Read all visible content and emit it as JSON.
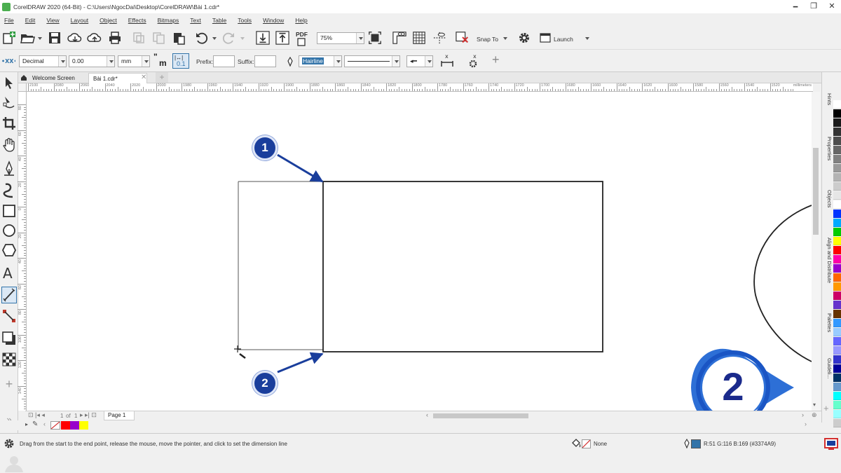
{
  "window": {
    "title": "CorelDRAW 2020 (64-Bit) - C:\\Users\\NgocDai\\Desktop\\CorelDRAW\\Bài 1.cdr*",
    "controls": [
      "🗕",
      "❐",
      "✕"
    ]
  },
  "menu": [
    {
      "label": "File"
    },
    {
      "label": "Edit"
    },
    {
      "label": "View"
    },
    {
      "label": "Layout"
    },
    {
      "label": "Object"
    },
    {
      "label": "Effects"
    },
    {
      "label": "Bitmaps"
    },
    {
      "label": "Text"
    },
    {
      "label": "Table"
    },
    {
      "label": "Tools"
    },
    {
      "label": "Window"
    },
    {
      "label": "Help"
    }
  ],
  "toolbar": {
    "zoom": "75%",
    "snap_to": "Snap To",
    "launch": "Launch",
    "pdf_label": "PDF"
  },
  "propbar": {
    "units_style": "Decimal",
    "precision": "0.00",
    "units": "mm",
    "prefix_label": "Prefix:",
    "suffix_label": "Suffix:",
    "outline_width": "Hairline",
    "unit_icon_text": "m",
    "dim_icon_text": "0.1"
  },
  "tabs": [
    {
      "label": "Welcome Screen",
      "active": false
    },
    {
      "label": "Bài 1.cdr*",
      "active": true
    }
  ],
  "ruler": {
    "h_ticks": [
      "2100",
      "2080",
      "2060",
      "2040",
      "2020",
      "2000",
      "1980",
      "1960",
      "1940",
      "1920",
      "1900",
      "1880",
      "1860",
      "1840",
      "1820",
      "1800",
      "1780",
      "1760",
      "1740",
      "1720",
      "1700",
      "1680",
      "1660",
      "1640",
      "1620",
      "1600",
      "1580",
      "1560",
      "1540",
      "1520"
    ],
    "unit": "millimeters",
    "v_ticks": [
      "80",
      "60",
      "40",
      "20",
      "0",
      "20",
      "40",
      "60",
      "80",
      "100",
      "120",
      "140"
    ]
  },
  "canvas": {
    "badge_1": "1",
    "badge_2": "2",
    "watermark": "2"
  },
  "page_nav": {
    "current": "1",
    "of": "of",
    "total": "1",
    "page_tab": "Page 1"
  },
  "docker_tabs": [
    "Hints",
    "Properties",
    "Objects",
    "Align and Distribute",
    "Palettes",
    "Guideli..."
  ],
  "palette": [
    "#ffffff",
    "#000000",
    "#1a1a1a",
    "#333333",
    "#4d4d4d",
    "#666666",
    "#808080",
    "#999999",
    "#b3b3b3",
    "#cccccc",
    "#e6e6e6",
    "#ffffff",
    "#0033ff",
    "#00aaff",
    "#00cc00",
    "#ffff00",
    "#ff0000",
    "#ff00aa",
    "#9900cc",
    "#ff6600",
    "#ff9900",
    "#cc0066",
    "#6633cc",
    "#663300",
    "#3399ff",
    "#99ccff",
    "#6666ff",
    "#9999ff",
    "#3333cc",
    "#000099",
    "#003366",
    "#6699cc",
    "#00ffff",
    "#66ffcc",
    "#99ffff",
    "#cccccc"
  ],
  "document_colors": [
    "#ff0000",
    "#9900cc",
    "#ffff00"
  ],
  "status": {
    "hint": "Drag from the start to the end point, release the mouse, move the pointer, and click to set the dimension line",
    "fill": "None",
    "outline_color_text": "R:51 G:116 B:169 (#3374A9)",
    "outline_swatch": "#3374a9"
  }
}
